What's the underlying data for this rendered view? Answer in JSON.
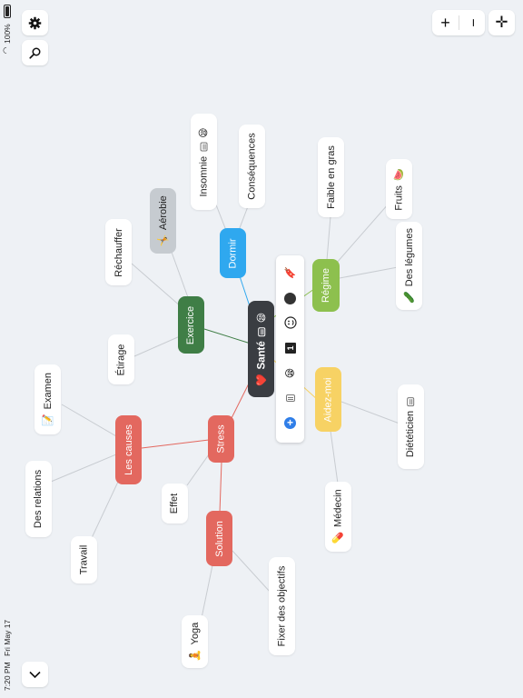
{
  "status": {
    "time": "7:20 PM",
    "date": "Fri May 17",
    "battery": "100%"
  },
  "controls": {
    "settings_icon": "gear-icon",
    "search_icon": "search-icon",
    "zoom_in_label": "+",
    "zoom_out_label": "−",
    "center_label": "✛",
    "collapse_icon": "chevron-down-icon"
  },
  "nodes": {
    "sante": "Santé",
    "sante_emoji": "❤️",
    "exercice": "Exercice",
    "aerobie": "Aérobie",
    "aerobie_emoji": "🤸",
    "rechauffer": "Réchauffer",
    "etirage": "Étirage",
    "dormir": "Dormir",
    "insomnie": "Insomnie",
    "insomnie_emoji": "😪",
    "consequences": "Conséquences",
    "regime": "Régime",
    "faible_en_gras": "Faible en gras",
    "fruits": "Fruits",
    "fruits_emoji": "🍉",
    "des_legumes": "Des légumes",
    "des_legumes_emoji": "🥒",
    "aidez_moi": "Aidez-moi",
    "dieteticien": "Diététicien",
    "medecin": "Médecin",
    "medecin_emoji": "💊",
    "stress": "Stress",
    "les_causes": "Les causes",
    "examen": "Examen",
    "examen_emoji": "📝",
    "des_relations": "Des relations",
    "travail": "Travail",
    "effet": "Effet",
    "solution": "Solution",
    "fixer": "Fixer des objectifs",
    "yoga": "Yoga",
    "yoga_emoji": "🧘"
  },
  "toolbar": {
    "items": [
      "sticker-icon",
      "color-dot-icon",
      "emoji-icon",
      "numbering-icon",
      "face-icon",
      "note-icon",
      "add-icon"
    ],
    "sticker": "🔖",
    "face": "😪",
    "number": "1"
  },
  "colors": {
    "background": "#eef1f5",
    "sante": "#3a3d42",
    "exercice": "#3f7e46",
    "aerobie": "#c6cbd0",
    "dormir": "#2fa8ef",
    "regime": "#8dc04e",
    "aidez_moi": "#f7d264",
    "stress": "#e3685f",
    "dot": "#333333",
    "add": "#2f7ee8"
  }
}
